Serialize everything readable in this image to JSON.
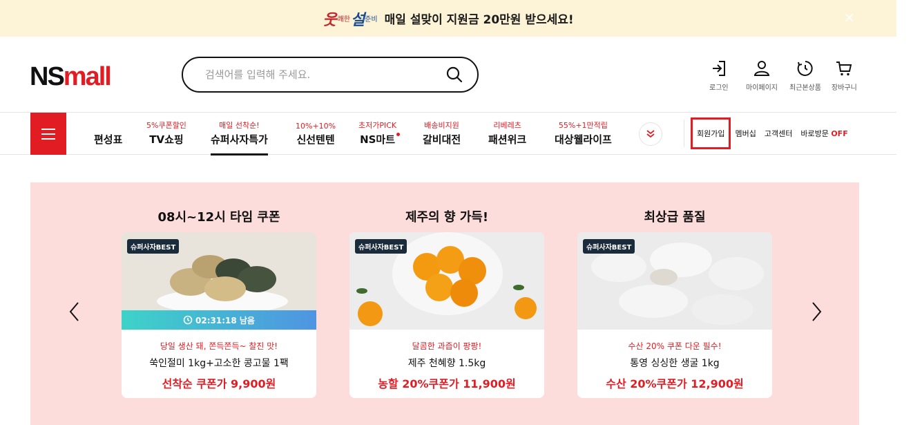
{
  "top_banner": {
    "logo_parts": [
      "웃",
      "쾌한",
      "설",
      "준비"
    ],
    "text": "매일 설맞이 지원금 20만원 받으세요!",
    "close": "×"
  },
  "header": {
    "logo_ns": "NS",
    "logo_mall": "mall",
    "search_placeholder": "검색어를 입력해 주세요.",
    "utils": [
      {
        "label": "로그인",
        "icon": "login-icon"
      },
      {
        "label": "마이페이지",
        "icon": "user-icon"
      },
      {
        "label": "최근본상품",
        "icon": "recent-icon"
      },
      {
        "label": "장바구니",
        "icon": "cart-icon"
      }
    ]
  },
  "gnb": {
    "items": [
      {
        "tag": "",
        "label": "편성표"
      },
      {
        "tag": "5%쿠폰할인",
        "label": "TV쇼핑"
      },
      {
        "tag": "매일 선착순!",
        "label": "슈퍼사자특가"
      },
      {
        "tag": "10%+10%",
        "label": "신선텐텐"
      },
      {
        "tag": "초저가PICK",
        "label": "NS마트"
      },
      {
        "tag": "배송비지원",
        "label": "갈비대전"
      },
      {
        "tag": "리베레츠",
        "label": "패션위크"
      },
      {
        "tag": "55%+1만적립",
        "label": "대상웰라이프"
      }
    ],
    "right_links": {
      "join": "회원가입",
      "membership": "멤버십",
      "customer_center": "고객센터",
      "visit": "바로방문",
      "visit_state": "OFF"
    }
  },
  "promo": {
    "cards": [
      {
        "title": "08시~12시 타임 쿠폰",
        "badge": "슈퍼사자BEST",
        "timer": "02:31:18 남음",
        "sub": "당일 생산 돼, 쫀득쫀득~ 찰진 맛!",
        "name": "쑥인절미 1kg+고소한 콩고물 1팩",
        "price": "선착순 쿠폰가 9,900원"
      },
      {
        "title": "제주의 향 가득!",
        "badge": "슈퍼사자BEST",
        "sub": "달콤한 과즙이 팡팡!",
        "name": "제주 천혜향 1.5kg",
        "price": "농할 20%쿠폰가 11,900원"
      },
      {
        "title": "최상급 품질",
        "badge": "슈퍼사자BEST",
        "sub": "수산 20% 쿠폰 다운 필수!",
        "name": "통영 싱싱한 생굴 1kg",
        "price": "수산 20%쿠폰가 12,900원"
      }
    ]
  },
  "colors": {
    "brand_red": "#e21c23",
    "banner_bg": "#fdf3d6",
    "promo_bg": "#fddddc",
    "timer_gradient": [
      "#3dd3c8",
      "#4f94e2"
    ]
  }
}
